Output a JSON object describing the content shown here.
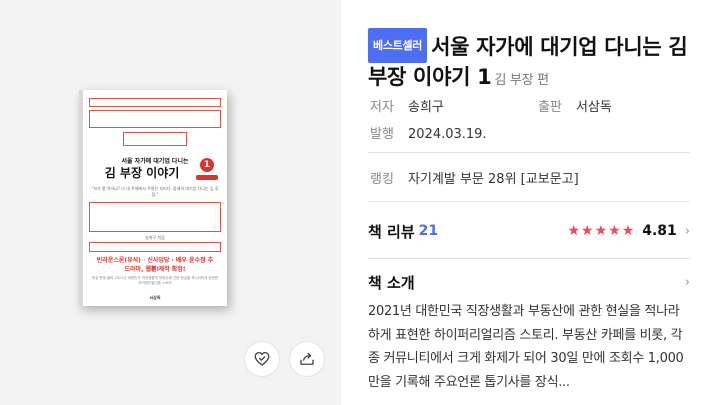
{
  "book": {
    "badge": "베스트셀러",
    "title": "서울 자가에 대기업 다니는 김 부장 이야기 1",
    "edition": "김 부장 편"
  },
  "meta": {
    "author_label": "저자",
    "author": "송희구",
    "publisher_label": "출판",
    "publisher": "서삼독",
    "date_label": "발행",
    "date": "2024.03.19.",
    "rank_label": "랭킹",
    "rank": "자기계발 부문 28위 [교보문고]"
  },
  "review": {
    "label": "책 리뷰",
    "count": "21",
    "rating": "4.81",
    "stars": 5
  },
  "intro": {
    "label": "책 소개",
    "text": "2021년 대한민국 직장생활과 부동산에 관한 현실을 적나라하게 표현한 하이퍼리얼리즘 스토리. 부동산 카페를 비롯, 각종 커뮤니티에서 크게 화제가 되어 30일 만에 조회수 1,000만을 기록해 주요언론 톱기사를 장식..."
  },
  "cover": {
    "title_small": "서울 자가에 대기업 다니는",
    "title_big": "김 부장 이야기",
    "volume": "1",
    "quote": "\"자가 몇 억이냐? 다 내 주제에서 주말은 부러다. 장래의 대기업 다니는 김 후 장.\"",
    "author": "송희구 지음",
    "promo_1": "빈라운스론(유석) · 신사임당 · 배우 윤수정 추천!",
    "promo_2": "드라마, 웹툰 제작 확정!",
    "fine": "현실 판매 돌파 2021년 대한민국 직장생활과 부동산에 관한 현실을 적나라하게 표현한 하이퍼리얼리즘 스토리",
    "publisher": "서삼독"
  },
  "colors": {
    "accent_blue": "#4e6ef2",
    "star_red": "#ef4a57",
    "cover_red": "#d9352e"
  },
  "icons": {
    "like": "heart-check-icon",
    "share": "share-icon"
  }
}
